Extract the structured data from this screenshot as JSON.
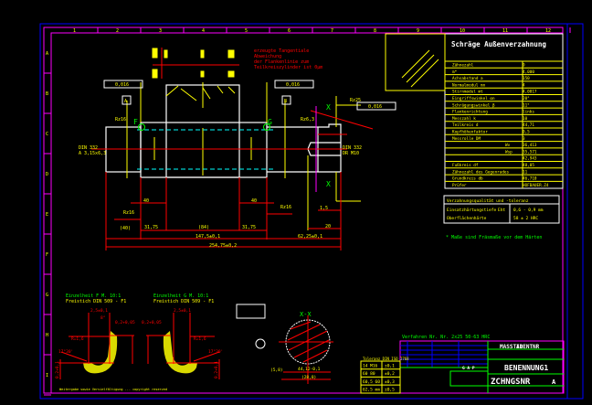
{
  "colors": {
    "frame": "#ff00ff",
    "border": "#0000ff",
    "yellow": "#ffff00",
    "red": "#ff0000",
    "white": "#ffffff",
    "green": "#00ff00",
    "cyan": "#00ffff"
  },
  "grid_top": [
    "1",
    "2",
    "3",
    "4",
    "5",
    "6",
    "7",
    "8",
    "9",
    "10",
    "11",
    "12"
  ],
  "grid_left": [
    "A",
    "B",
    "C",
    "D",
    "E",
    "F",
    "G",
    "H",
    "I"
  ],
  "gear_table": {
    "title": "Schräge Außenverzahnung",
    "rows": [
      {
        "label": "Zähnezahl",
        "value": "9"
      },
      {
        "label": "m*",
        "value": "4,000"
      },
      {
        "label": "Achsabstand a",
        "value": "150"
      },
      {
        "label": "Normalmodul mn",
        "value": "4"
      },
      {
        "label": "Stirnmodul mt",
        "value": "4,0817"
      },
      {
        "label": "Eingriffswinkel αn",
        "value": "20°"
      },
      {
        "label": "Schrägungswinkel β",
        "value": "11°"
      },
      {
        "label": "Flankenrichtung",
        "value": "links"
      },
      {
        "label": "Messzahl k",
        "value": "10"
      },
      {
        "label": "Teilkreis d",
        "value": "44,71"
      },
      {
        "label": "Kopfhöhenfaktor",
        "value": "0,5"
      },
      {
        "label": "Messrolle DM",
        "value": "3"
      },
      {
        "label": "Wv",
        "value": "36,413"
      },
      {
        "label": "Wsp",
        "value": "35,571"
      },
      {
        "label": "",
        "value": "42,943"
      },
      {
        "label": "Fußkreis df",
        "value": "48,05"
      },
      {
        "label": "Zähnezahl des Gegenrades",
        "value": "11"
      },
      {
        "label": "Grundkreis db",
        "value": "46,710"
      },
      {
        "label": "Prüfer",
        "value": "HOFBAUER.Z4"
      }
    ],
    "quality_header": "Verzahnungsqualität und -toleranz",
    "quality_rows": [
      {
        "label": "Einsatzhärtungstiefe",
        "unit": "Eht",
        "value": "0,6 - 0,9 mm"
      },
      {
        "label": "Oberflächenhärte",
        "unit": "",
        "value": "58 ± 2 HRC"
      }
    ],
    "note": "* Maße sind Fräsmaße vor dem Härten"
  },
  "drawing": {
    "red_note": [
      "erzeugte Tangentiale",
      "Abweichung",
      "der Flankenlinie zum",
      "Teilkreiszylinder ist 0µm"
    ],
    "tol_left": "0,016",
    "tol_right": "0,016",
    "tol_far": "0,016",
    "datum_a": "A",
    "datum_b": "B",
    "label_f": "F",
    "label_g": "G",
    "section_x": "X",
    "din_left": [
      "DIN 332",
      "A 3,15x6,3"
    ],
    "din_right": [
      "DIN 332",
      "DR M10"
    ],
    "rough": [
      "Rz16",
      "Rz6,3",
      "Rz16",
      "Rz16",
      "Rz25"
    ],
    "dims_bottom": [
      "(40)",
      "147,5±0,1",
      "62,25±0,1",
      "254,75±0,2",
      "31,75",
      "(84)",
      "31,75",
      "40",
      "40",
      "20",
      "1,5"
    ]
  },
  "details": {
    "f_title": "Einzelheit F M. 10:1",
    "f_sub": "Freistich DIN 509 - F1",
    "g_title": "Einzelheit G M. 10:1",
    "g_sub": "Freistich DIN 509 - F1",
    "f_dims": [
      "2,5±0,1",
      "R=1,6",
      "0,2+0,05",
      "17°30'",
      "0,2+0,1",
      "8°"
    ],
    "g_dims": [
      "2,5±0,1",
      "R=1,6",
      "0,2+0,05",
      "17°30'",
      "0,2+0,1",
      "8°"
    ],
    "xx_title": "X-X",
    "xx_dims": [
      "(5,8)",
      "44,12-0,1",
      "(28,8)"
    ],
    "copyright": "Weitergabe sowie Vervielfältigung ... copyright reserved"
  },
  "title_block": {
    "process": "Verfahren Nr. Nr. 2x25 50-63 HRC",
    "scale_label": "MASSTAB",
    "ident": "IDENTNR",
    "benennung": "BENENNUNG1",
    "zeichnungsnr": "ZCHNGSNR",
    "index": "A",
    "small_rows": [
      {
        "a": "14 M16",
        "b": "±0,1"
      },
      {
        "a": "60 80",
        "b": "±0,2"
      },
      {
        "a": "60,5 60",
        "b": "±0,3"
      },
      {
        "a": "62,5 mm",
        "b": "±0,5"
      }
    ],
    "small_header": "Toleranz DIN ISO 2768",
    "gap": "G A P"
  }
}
